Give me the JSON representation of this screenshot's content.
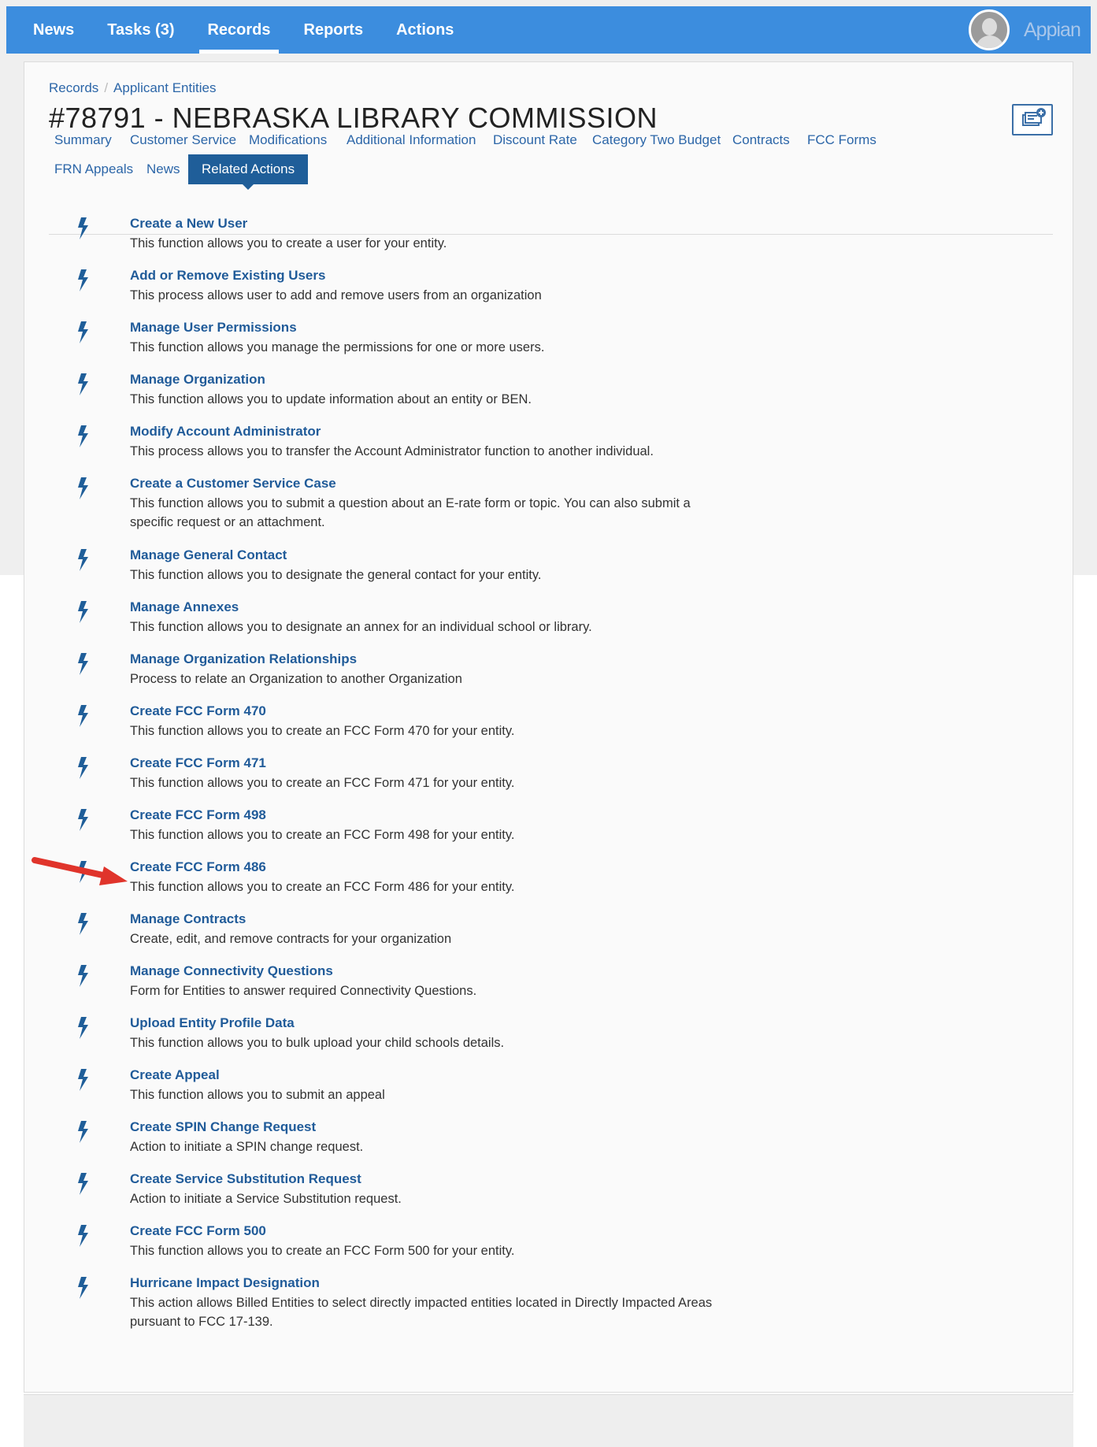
{
  "nav": {
    "items": [
      "News",
      "Tasks (3)",
      "Records",
      "Reports",
      "Actions"
    ],
    "active": "Records",
    "brand": "Appian"
  },
  "breadcrumb": [
    "Records",
    "Applicant Entities"
  ],
  "page_title": "#78791 - NEBRASKA LIBRARY COMMISSION",
  "tabs": [
    "Summary",
    "Customer Service",
    "Modifications",
    "Additional Information",
    "Discount Rate",
    "Category Two Budget",
    "Contracts",
    "FCC Forms",
    "FRN Appeals",
    "News",
    "Related Actions"
  ],
  "active_tab": "Related Actions",
  "related_actions": [
    {
      "title": "Create a New User",
      "desc": "This function allows you to create a user for your entity."
    },
    {
      "title": "Add or Remove Existing Users",
      "desc": "This process allows user to add and remove users from an organization"
    },
    {
      "title": "Manage User Permissions",
      "desc": "This function allows you manage the permissions for one or more users."
    },
    {
      "title": "Manage Organization",
      "desc": "This function allows you to update information about an entity or BEN."
    },
    {
      "title": "Modify Account Administrator",
      "desc": "This process allows you to transfer the Account Administrator function to another individual."
    },
    {
      "title": "Create a Customer Service Case",
      "desc": "This function allows you to submit a question about an E-rate form or topic. You can also submit a specific request or an attachment."
    },
    {
      "title": "Manage General Contact",
      "desc": "This function allows you to designate the general contact for your entity."
    },
    {
      "title": "Manage Annexes",
      "desc": "This function allows you to designate an annex for an individual school or library."
    },
    {
      "title": "Manage Organization Relationships",
      "desc": "Process to relate an Organization to another Organization"
    },
    {
      "title": "Create FCC Form 470",
      "desc": "This function allows you to create an FCC Form 470 for your entity."
    },
    {
      "title": "Create FCC Form 471",
      "desc": "This function allows you to create an FCC Form 471 for your entity."
    },
    {
      "title": "Create FCC Form 498",
      "desc": "This function allows you to create an FCC Form 498 for your entity."
    },
    {
      "title": "Create FCC Form 486",
      "desc": "This function allows you to create an FCC Form 486 for your entity."
    },
    {
      "title": "Manage Contracts",
      "desc": "Create, edit, and remove contracts for your organization"
    },
    {
      "title": "Manage Connectivity Questions",
      "desc": "Form for Entities to answer required Connectivity Questions."
    },
    {
      "title": "Upload Entity Profile Data",
      "desc": "This function allows you to bulk upload your child schools details."
    },
    {
      "title": "Create Appeal",
      "desc": "This function allows you to submit an appeal"
    },
    {
      "title": "Create SPIN Change Request",
      "desc": "Action to initiate a SPIN change request."
    },
    {
      "title": "Create Service Substitution Request",
      "desc": "Action to initiate a Service Substitution request."
    },
    {
      "title": "Create FCC Form 500",
      "desc": "This function allows you to create an FCC Form 500 for your entity."
    },
    {
      "title": "Hurricane Impact Designation",
      "desc": "This action allows Billed Entities to select directly impacted entities located in Directly Impacted Areas pursuant to FCC 17-139."
    }
  ],
  "icons": {
    "action": "lightning-bolt-icon",
    "user": "user-avatar-icon",
    "record_action": "record-action-icon",
    "annotation": "red-arrow-icon"
  },
  "colors": {
    "topbar": "#3c8dde",
    "link": "#205b99",
    "active_tab": "#1f5e99",
    "arrow": "#e0342b"
  }
}
